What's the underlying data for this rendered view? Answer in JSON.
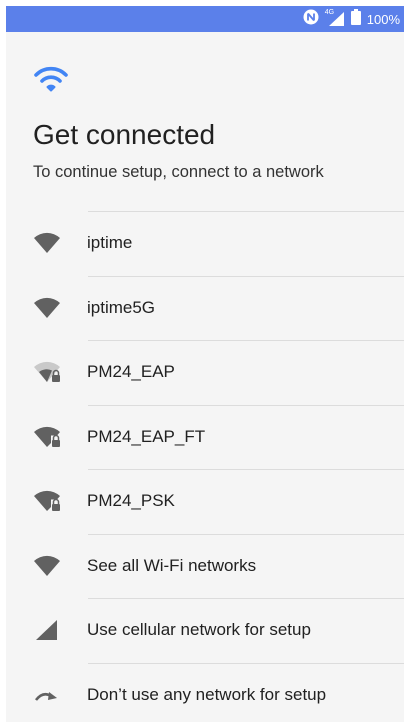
{
  "status": {
    "battery": "100%",
    "network": "4G"
  },
  "header": {
    "title": "Get connected",
    "subtitle": "To continue setup, connect to a network"
  },
  "networks": [
    {
      "label": "iptime",
      "icon": "wifi-icon"
    },
    {
      "label": "iptime5G",
      "icon": "wifi-icon"
    },
    {
      "label": "PM24_EAP",
      "icon": "wifi-lock-weak-icon"
    },
    {
      "label": "PM24_EAP_FT",
      "icon": "wifi-lock-icon"
    },
    {
      "label": "PM24_PSK",
      "icon": "wifi-lock-icon"
    },
    {
      "label": "See all Wi-Fi networks",
      "icon": "wifi-icon"
    },
    {
      "label": "Use cellular network for setup",
      "icon": "cellular-icon"
    },
    {
      "label": "Don’t use any network for setup",
      "icon": "skip-arrow-icon"
    }
  ],
  "colors": {
    "accent": "#4285f4",
    "statusbar": "#5b80ea",
    "icon": "#616161"
  }
}
